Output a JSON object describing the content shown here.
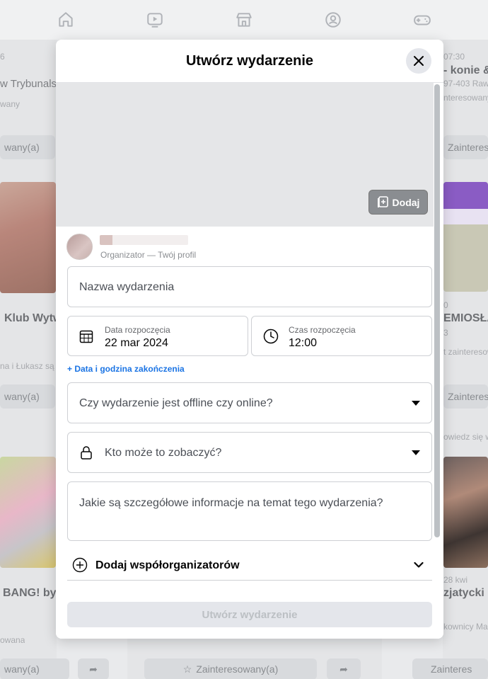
{
  "modal": {
    "title": "Utwórz wydarzenie",
    "add_cover_label": "Dodaj",
    "organizer_sub": "Organizator — Twój profil",
    "event_name_placeholder": "Nazwa wydarzenia",
    "start_date_label": "Data rozpoczęcia",
    "start_date_value": "22 mar 2024",
    "start_time_label": "Czas rozpoczęcia",
    "start_time_value": "12:00",
    "end_link": "+ Data i godzina zakończenia",
    "location_type_placeholder": "Czy wydarzenie jest offline czy online?",
    "privacy_placeholder": "Kto może to zobaczyć?",
    "details_placeholder": "Jakie są szczegółowe informacje na temat tego wydarzenia?",
    "cohosts_label": "Dodaj współorganizatorów",
    "create_button": "Utwórz wydarzenie"
  },
  "background": {
    "left_texts": [
      "6",
      "w Trybunalsk",
      "wany",
      "wany(a)",
      "Klub Wytw",
      "na i Łukasz są z",
      "wany(a)",
      "BANG! by S",
      "owana",
      "wany(a)"
    ],
    "right_texts": [
      "07:30",
      "- konie &",
      "97-403 Raw",
      "nteresowanych",
      "Zainteres",
      "0",
      "EMIOSŁA",
      "3",
      "t zainteresow",
      "Zainteres",
      "owiedz się w",
      "28 kwi",
      "zjatycki B",
      "kownicy Ma",
      "Zainteres"
    ],
    "bottom_button": "Zainteresowany(a)"
  },
  "icons": {
    "nav": [
      "home-icon",
      "video-icon",
      "marketplace-icon",
      "groups-icon",
      "gaming-icon"
    ]
  },
  "colors": {
    "accent": "#1b74e4",
    "disabled_button": "#e4e6eb"
  }
}
